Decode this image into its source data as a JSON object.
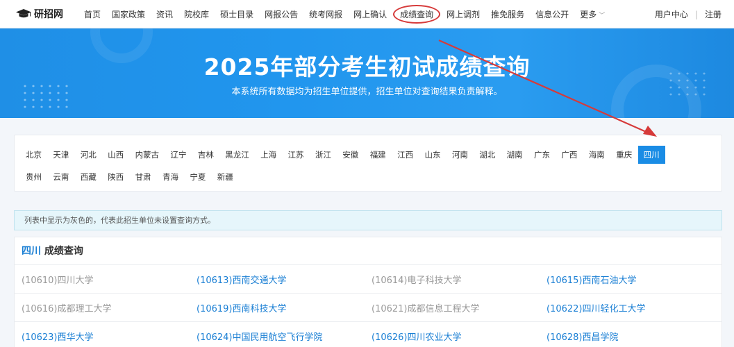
{
  "header": {
    "logo_text": "研招网",
    "nav": [
      {
        "label": "首页"
      },
      {
        "label": "国家政策"
      },
      {
        "label": "资讯"
      },
      {
        "label": "院校库"
      },
      {
        "label": "硕士目录"
      },
      {
        "label": "网报公告"
      },
      {
        "label": "统考网报"
      },
      {
        "label": "网上确认"
      },
      {
        "label": "成绩查询",
        "circled": true
      },
      {
        "label": "网上调剂"
      },
      {
        "label": "推免服务"
      },
      {
        "label": "信息公开"
      },
      {
        "label": "更多",
        "has_caret": true
      }
    ],
    "user_center": "用户中心",
    "separator": "|",
    "register": "注册"
  },
  "banner": {
    "title": "2025年部分考生初试成绩查询",
    "subtitle": "本系统所有数据均为招生单位提供，招生单位对查询结果负责解释。"
  },
  "provinces": {
    "row1": [
      "北京",
      "天津",
      "河北",
      "山西",
      "内蒙古",
      "辽宁",
      "吉林",
      "黑龙江",
      "上海",
      "江苏",
      "浙江",
      "安徽",
      "福建",
      "江西",
      "山东",
      "河南",
      "湖北",
      "湖南",
      "广东",
      "广西",
      "海南",
      "重庆",
      "四川"
    ],
    "row2": [
      "贵州",
      "云南",
      "西藏",
      "陕西",
      "甘肃",
      "青海",
      "宁夏",
      "新疆"
    ],
    "active": "四川"
  },
  "notice": "列表中显示为灰色的，代表此招生单位未设置查询方式。",
  "results": {
    "province": "四川",
    "title_suffix": "成绩查询",
    "rows": [
      [
        {
          "text": "(10610)四川大学",
          "enabled": false
        },
        {
          "text": "(10613)西南交通大学",
          "enabled": true
        },
        {
          "text": "(10614)电子科技大学",
          "enabled": false
        },
        {
          "text": "(10615)西南石油大学",
          "enabled": true
        }
      ],
      [
        {
          "text": "(10616)成都理工大学",
          "enabled": false
        },
        {
          "text": "(10619)西南科技大学",
          "enabled": true
        },
        {
          "text": "(10621)成都信息工程大学",
          "enabled": false
        },
        {
          "text": "(10622)四川轻化工大学",
          "enabled": true
        }
      ],
      [
        {
          "text": "(10623)西华大学",
          "enabled": true
        },
        {
          "text": "(10624)中国民用航空飞行学院",
          "enabled": true
        },
        {
          "text": "(10626)四川农业大学",
          "enabled": true
        },
        {
          "text": "(10628)西昌学院",
          "enabled": true
        }
      ]
    ]
  },
  "colors": {
    "brand_blue": "#1a8ce5",
    "link_blue": "#1a7fd4",
    "disabled_gray": "#999999",
    "annotation_red": "#d63a3a"
  },
  "icons": {
    "logo": "graduation-cap-icon",
    "more": "chevron-down-icon"
  }
}
